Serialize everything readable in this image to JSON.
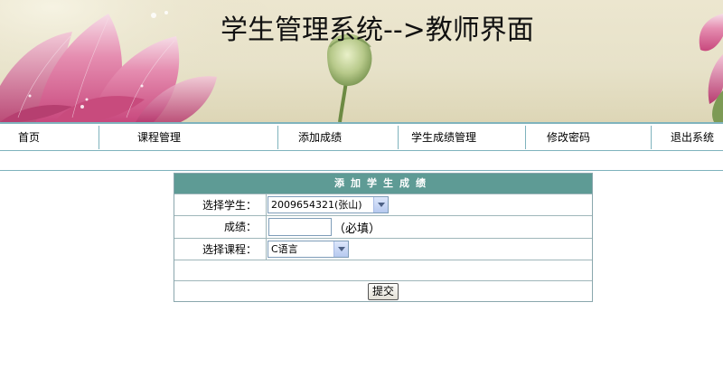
{
  "banner": {
    "title": "学生管理系统-->教师界面"
  },
  "nav": {
    "items": [
      "首页",
      "课程管理",
      "添加成绩",
      "学生成绩管理",
      "修改密码",
      "退出系统"
    ]
  },
  "form": {
    "heading": "添加学生成绩",
    "student_label": "选择学生：",
    "student_selected": "2009654321(张山)",
    "score_label": "成绩：",
    "score_value": "",
    "score_hint": "（必填）",
    "course_label": "选择课程：",
    "course_selected": "C语言",
    "submit_label": "提交"
  },
  "colors": {
    "header_bar": "#5e9b95",
    "nav_border": "#7fb3bd",
    "lotus_pink": "#d9789f"
  }
}
